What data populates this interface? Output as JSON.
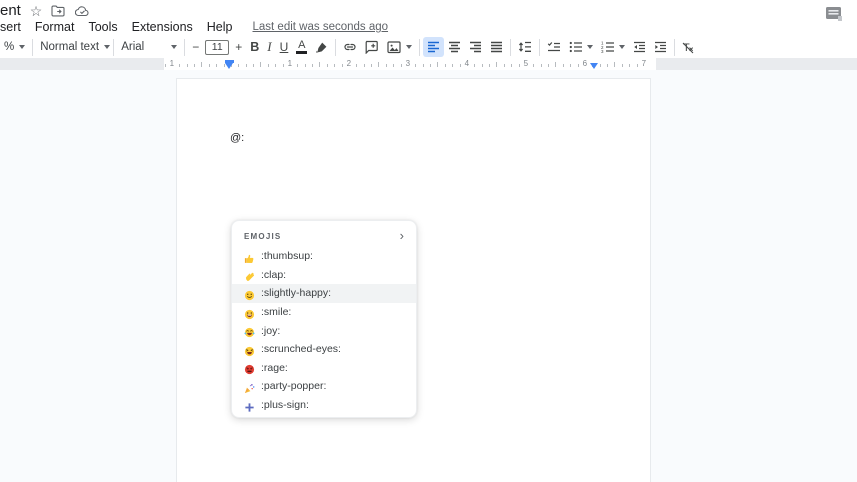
{
  "titlebar": {
    "title_fragment": "ent",
    "icons": {
      "star": "☆",
      "move_to_folder": "folder-move-icon",
      "saved_status": "cloud-check-icon",
      "side_panel": "panel-icon"
    }
  },
  "menubar": {
    "items": [
      "sert",
      "Format",
      "Tools",
      "Extensions",
      "Help"
    ],
    "last_edit": "Last edit was seconds ago"
  },
  "toolbar": {
    "zoom_fragment": "%",
    "paragraph_style": "Normal text",
    "font": "Arial",
    "font_size": "11",
    "minus": "−",
    "plus": "+",
    "bold": "B",
    "italic": "I",
    "underline": "U",
    "text_color": "A"
  },
  "ruler": {
    "numbers_left": [
      "1"
    ],
    "numbers": [
      "1",
      "2",
      "3",
      "4",
      "5",
      "6",
      "7"
    ]
  },
  "document": {
    "text": "@:"
  },
  "emoji_menu": {
    "header": "EMOJIS",
    "chevron": "›",
    "items": [
      {
        "icon": "thumbsup-emoji",
        "label": ":thumbsup:",
        "highlighted": false
      },
      {
        "icon": "clap-emoji",
        "label": ":clap:",
        "highlighted": false
      },
      {
        "icon": "slightly-happy-emoji",
        "label": ":slightly-happy:",
        "highlighted": true
      },
      {
        "icon": "smile-emoji",
        "label": ":smile:",
        "highlighted": false
      },
      {
        "icon": "joy-emoji",
        "label": ":joy:",
        "highlighted": false
      },
      {
        "icon": "scrunched-eyes-emoji",
        "label": ":scrunched-eyes:",
        "highlighted": false
      },
      {
        "icon": "rage-emoji",
        "label": ":rage:",
        "highlighted": false
      },
      {
        "icon": "party-popper-emoji",
        "label": ":party-popper:",
        "highlighted": false
      },
      {
        "icon": "plus-sign-emoji",
        "label": ":plus-sign:",
        "highlighted": false
      }
    ]
  },
  "colors": {
    "accent_blue": "#4285f4",
    "active_button_bg": "#d2e3fc",
    "highlight_row": "#f1f3f4",
    "icon_gray": "#444746",
    "text_gray": "#5f6368",
    "canvas_bg": "#f9fbfd",
    "emoji_yellow": "#fcc934",
    "rage_red": "#e23e33",
    "plus_indigo": "#5c6bc0"
  }
}
